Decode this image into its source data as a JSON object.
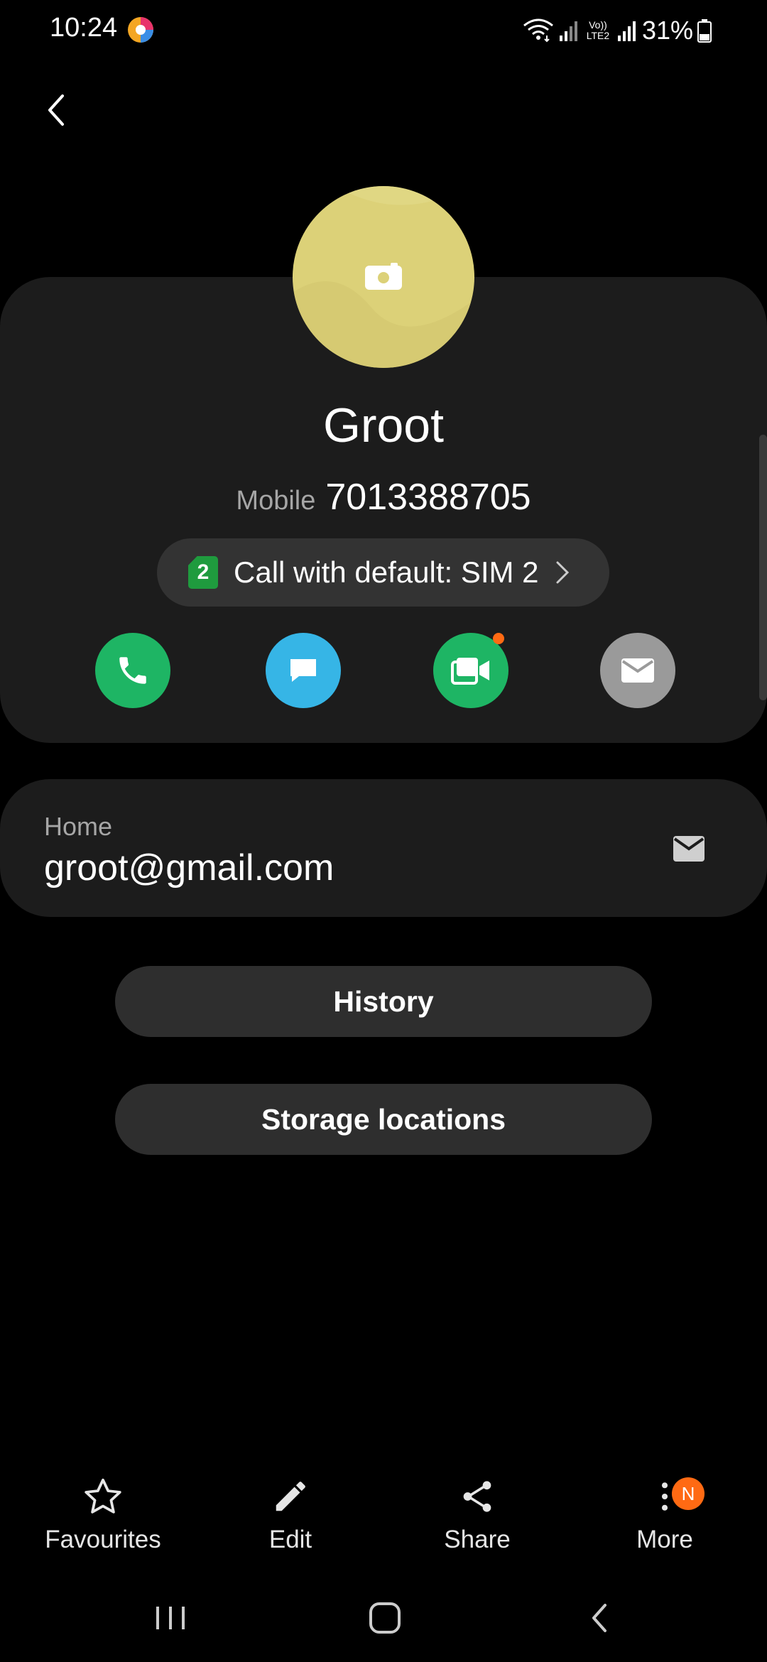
{
  "status_bar": {
    "time": "10:24",
    "battery": "31%",
    "network_label": "Vo)) LTE2"
  },
  "contact": {
    "name": "Groot",
    "phone_label": "Mobile",
    "phone_number": "7013388705",
    "sim": {
      "number": "2",
      "label": "Call with default: SIM 2"
    },
    "avatar_color": "#dcd178",
    "actions": [
      {
        "name": "call",
        "color": "#1eb564"
      },
      {
        "name": "message",
        "color": "#36b5e6"
      },
      {
        "name": "video-call",
        "color": "#1eb564"
      },
      {
        "name": "email",
        "color": "#9a9a9a"
      }
    ]
  },
  "email": {
    "label": "Home",
    "value": "groot@gmail.com"
  },
  "buttons": {
    "history": "History",
    "storage": "Storage locations"
  },
  "bottom_bar": {
    "favourites": "Favourites",
    "edit": "Edit",
    "share": "Share",
    "more": "More",
    "more_badge": "N"
  }
}
